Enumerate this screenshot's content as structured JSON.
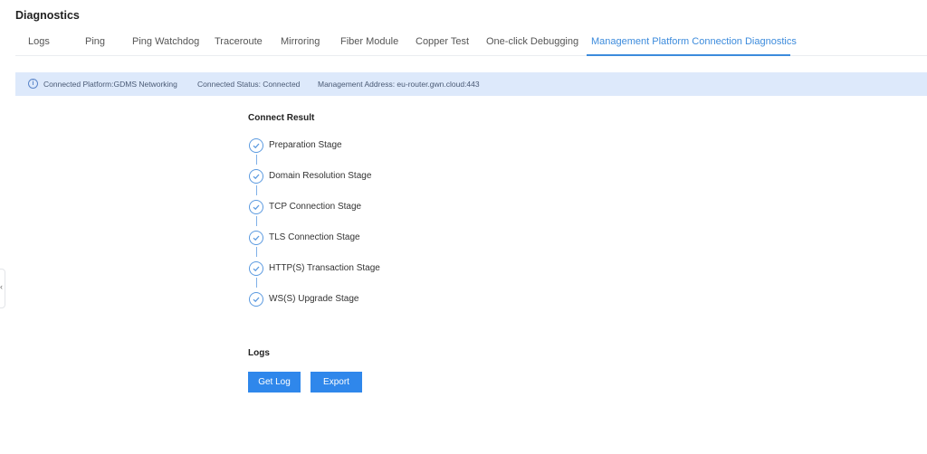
{
  "page": {
    "title": "Diagnostics"
  },
  "tabs": [
    {
      "label": "Logs"
    },
    {
      "label": "Ping"
    },
    {
      "label": "Ping Watchdog"
    },
    {
      "label": "Traceroute"
    },
    {
      "label": "Mirroring"
    },
    {
      "label": "Fiber Module"
    },
    {
      "label": "Copper Test"
    },
    {
      "label": "One-click Debugging"
    },
    {
      "label": "Management Platform Connection Diagnostics",
      "active": true
    }
  ],
  "info": {
    "platform": "Connected Platform:GDMS Networking",
    "status": "Connected Status: Connected",
    "address": "Management Address: eu-router.gwn.cloud:443"
  },
  "connect_result": {
    "title": "Connect Result",
    "stages": [
      {
        "label": "Preparation Stage",
        "status": "success"
      },
      {
        "label": "Domain Resolution Stage",
        "status": "success"
      },
      {
        "label": "TCP Connection Stage",
        "status": "success"
      },
      {
        "label": "TLS Connection Stage",
        "status": "success"
      },
      {
        "label": "HTTP(S) Transaction Stage",
        "status": "success"
      },
      {
        "label": "WS(S) Upgrade Stage",
        "status": "success"
      }
    ]
  },
  "logs": {
    "title": "Logs",
    "get_log_label": "Get Log",
    "export_label": "Export"
  },
  "sidebar_toggle": {
    "icon": "collapse-arrow-icon"
  },
  "colors": {
    "accent": "#2f87eb",
    "info_bg": "#dde9fb",
    "active_tab": "#3c8bdc"
  }
}
